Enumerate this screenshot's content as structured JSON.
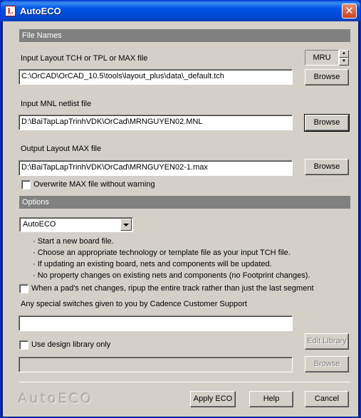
{
  "window": {
    "title": "AutoECO",
    "app_icon": "orcad-icon",
    "close_icon": "close-icon"
  },
  "file_names": {
    "header": "File Names",
    "input_layout": {
      "label": "Input Layout TCH or TPL or MAX file",
      "value": "C:\\OrCAD\\OrCAD_10.5\\tools\\layout_plus\\data\\_default.tch",
      "button": "Browse"
    },
    "mru": {
      "label": "MRU"
    },
    "input_netlist": {
      "label": "Input MNL netlist file",
      "value": "D:\\BaiTapLapTrinhVDK\\OrCad\\MRNGUYEN02.MNL",
      "button": "Browse"
    },
    "output_layout": {
      "label": "Output Layout MAX file",
      "value": "D:\\BaiTapLapTrinhVDK\\OrCad\\MRNGUYEN02-1.max",
      "button": "Browse"
    },
    "overwrite": {
      "label": "Overwrite MAX file without warning",
      "checked": false
    }
  },
  "options": {
    "header": "Options",
    "mode": {
      "selected": "AutoECO"
    },
    "notes": [
      "· Start a new board file.",
      "· Choose an appropriate technology or template file as your input TCH file.",
      "· If updating an existing board, nets and components will be updated.",
      "· No property changes on existing nets and components (no Footprint changes)."
    ],
    "ripup": {
      "label": "When a pad's net changes, ripup the entire track rather than just the last segment",
      "checked": false
    },
    "switches": {
      "label": "Any special switches given to you by Cadence Customer Support",
      "value": ""
    },
    "design_library": {
      "label": "Use design library only",
      "checked": false,
      "edit_button": "Edit Library",
      "value": "",
      "browse_button": "Browse"
    }
  },
  "footer": {
    "watermark": "AutoECO",
    "apply": "Apply ECO",
    "help": "Help",
    "cancel": "Cancel"
  }
}
